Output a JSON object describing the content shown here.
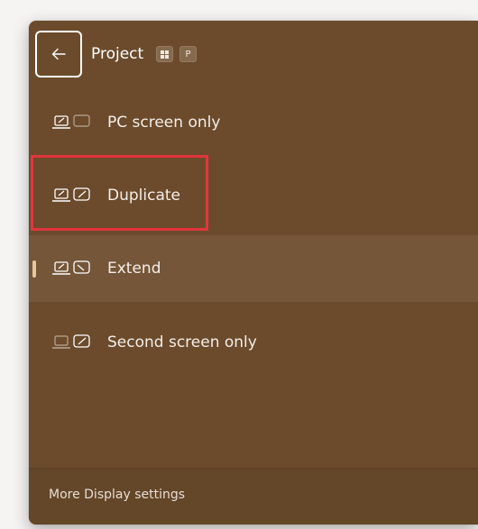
{
  "panel": {
    "title": "Project",
    "shortcut_keys": [
      "windows-key-icon",
      "P"
    ],
    "back_icon": "back-arrow-icon"
  },
  "options": [
    {
      "label": "PC screen only",
      "icon": "pc-screen-only-icon",
      "selected": false
    },
    {
      "label": "Duplicate",
      "icon": "duplicate-icon",
      "selected": false
    },
    {
      "label": "Extend",
      "icon": "extend-icon",
      "selected": true
    },
    {
      "label": "Second screen only",
      "icon": "second-screen-only-icon",
      "selected": false
    }
  ],
  "footer": {
    "link": "More Display settings"
  },
  "colors": {
    "panel_bg": "#6b4b2c",
    "selected_bg": "#755639",
    "accent": "#e4c99a",
    "highlight": "#e2353d"
  }
}
